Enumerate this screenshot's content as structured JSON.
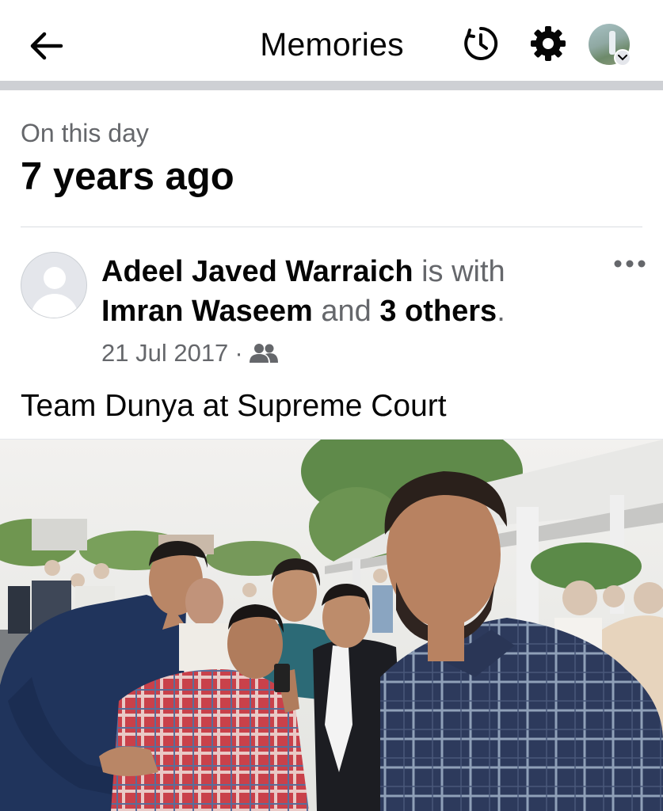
{
  "header": {
    "title": "Memories",
    "back_icon": "back-arrow-icon",
    "history_icon": "clock-history-icon",
    "settings_icon": "gear-icon"
  },
  "memory": {
    "label": "On this day",
    "years_ago": "7 years ago"
  },
  "post": {
    "author": "Adeel Javed Warraich",
    "is_with": "is with",
    "tagged": "Imran Waseem",
    "and": "and",
    "others": "3 others",
    "period": ".",
    "date": "21 Jul 2017",
    "separator": "·",
    "audience_icon": "friends-icon",
    "caption": "Team Dunya at Supreme Court"
  },
  "colors": {
    "text_primary": "#050505",
    "text_secondary": "#65676b",
    "divider": "#ced0d4"
  }
}
